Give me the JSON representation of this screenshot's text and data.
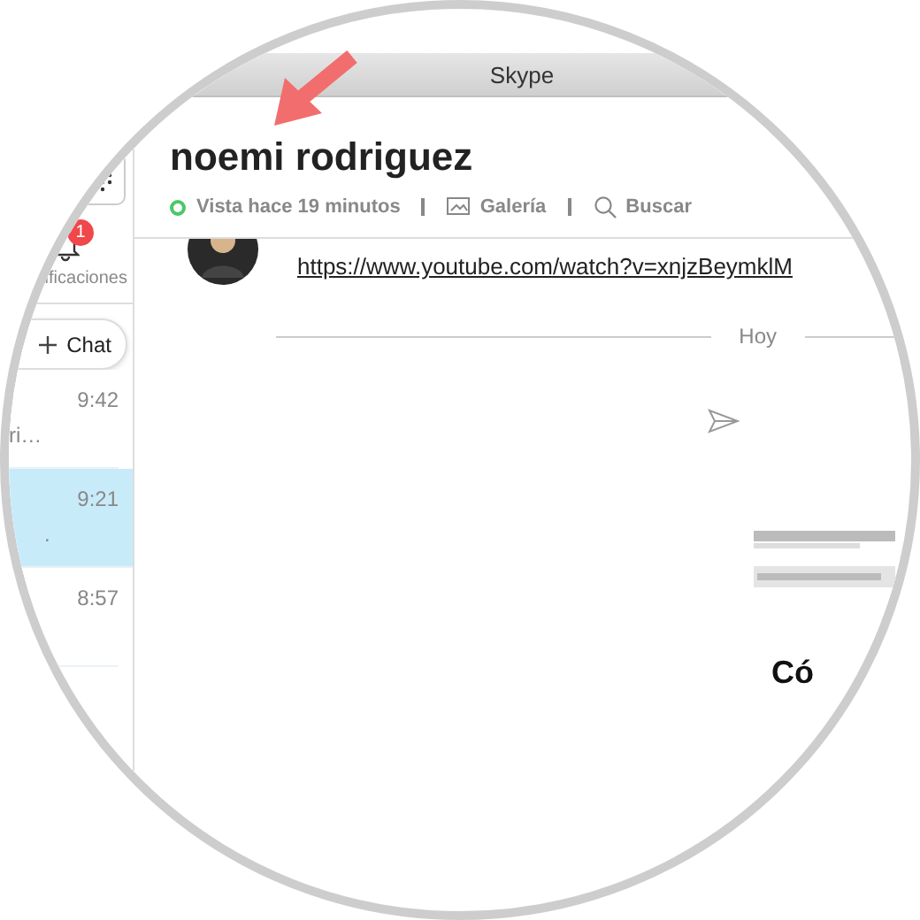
{
  "window": {
    "title": "Skype"
  },
  "annotation": {
    "kind": "arrow"
  },
  "sidebar": {
    "notifications": {
      "badge": "1",
      "label": "ificaciones"
    },
    "new_chat": {
      "label": "Chat"
    },
    "chats": [
      {
        "time": "9:42",
        "preview": "ri…",
        "selected": false
      },
      {
        "time": "9:21",
        "preview": ".",
        "selected": true
      },
      {
        "time": "8:57",
        "selected": false
      }
    ]
  },
  "conversation": {
    "name": "noemi rodriguez",
    "status": {
      "text": "Vista hace 19 minutos",
      "online": true
    },
    "actions": [
      {
        "kind": "gallery",
        "label": "Galería"
      },
      {
        "kind": "search",
        "label": "Buscar"
      }
    ],
    "messages": [
      {
        "kind": "link",
        "text": "https://www.youtube.com/watch?v=xnjzBeymklM"
      }
    ],
    "date_separator": "Hoy",
    "preview": {
      "kind": "picture",
      "heading": "Có"
    }
  }
}
